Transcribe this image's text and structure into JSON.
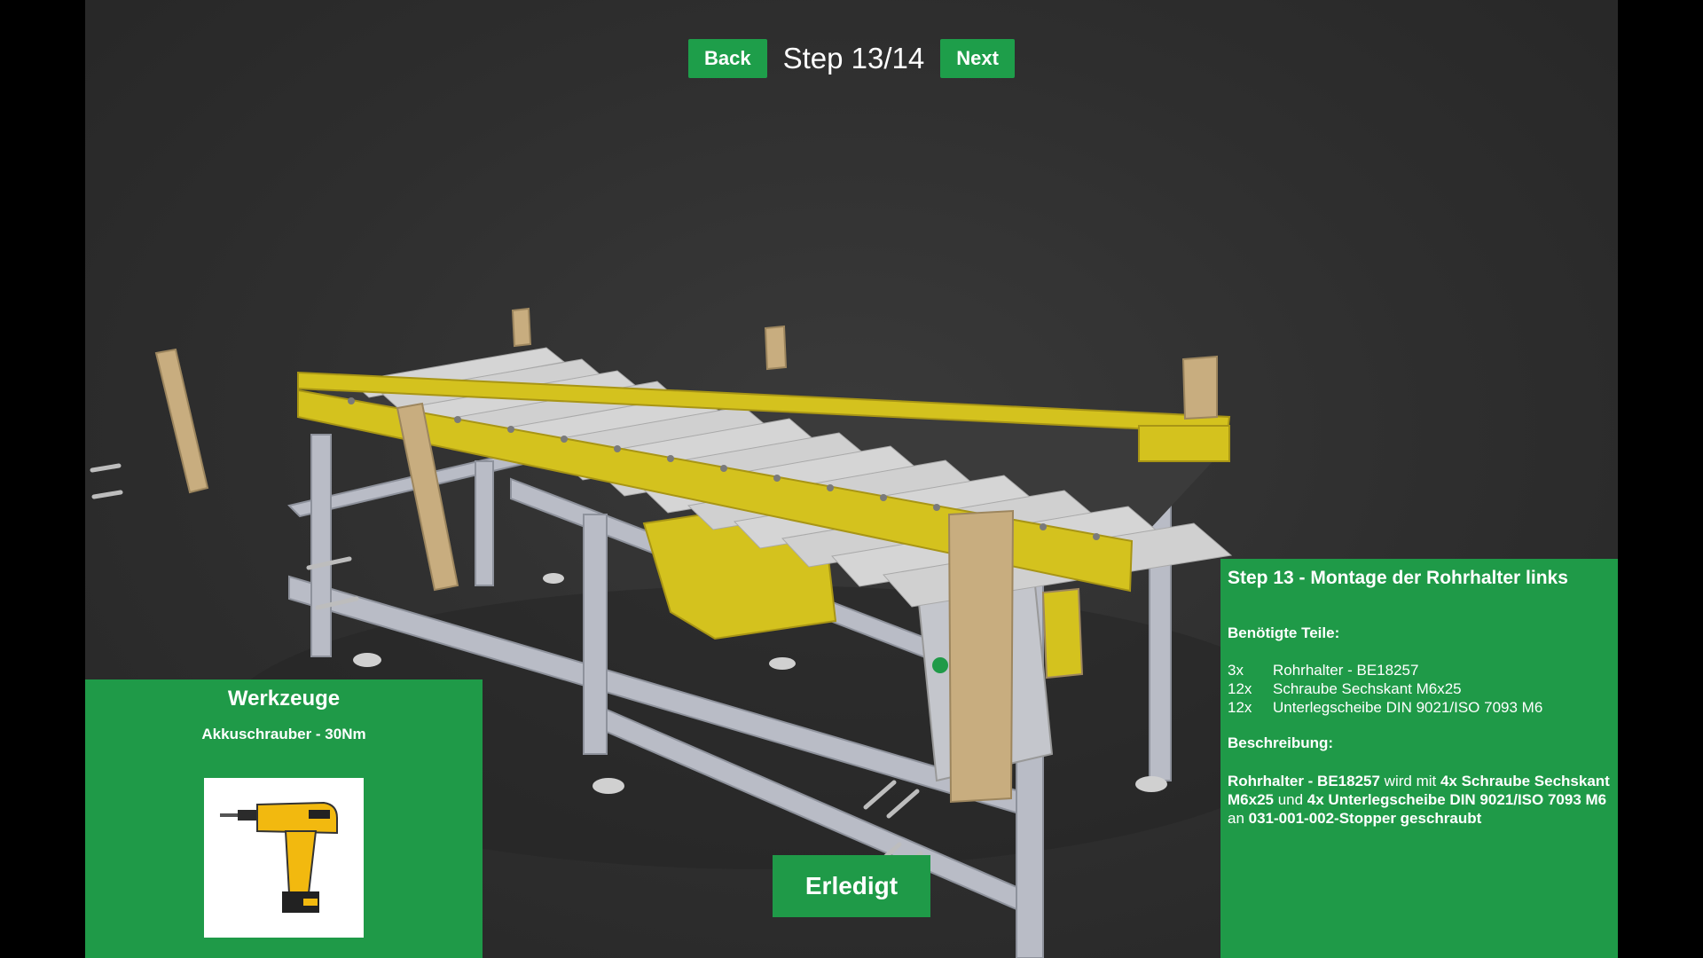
{
  "nav": {
    "back_label": "Back",
    "step_text": "Step 13/14",
    "next_label": "Next"
  },
  "tools_panel": {
    "title": "Werkzeuge",
    "tool_name": "Akkuschrauber - 30Nm",
    "tool_icon": "cordless-drill-icon"
  },
  "info_panel": {
    "title": "Step 13 - Montage der Rohrhalter links",
    "parts_heading": "Benötigte Teile:",
    "parts": [
      {
        "qty": "3x",
        "name": "Rohrhalter - BE18257"
      },
      {
        "qty": "12x",
        "name": "Schraube Sechskant M6x25"
      },
      {
        "qty": "12x",
        "name": "Unterlegscheibe DIN 9021/ISO 7093 M6"
      }
    ],
    "description_heading": "Beschreibung:",
    "description": {
      "part": "Rohrhalter - BE18257",
      "t1": " wird mit ",
      "screws": "4x Schraube Sechskant M6x25",
      "t2": " und ",
      "washers": "4x Unterlegscheibe DIN 9021/ISO 7093 M6",
      "t3": " an ",
      "target": "031-001-002-Stopper geschraubt"
    }
  },
  "done_label": "Erledigt",
  "colors": {
    "accent_green": "#1f9a48",
    "frame_yellow": "#d4c21e",
    "roller_grey": "#c9c9c9",
    "frame_steel": "#b9bcc6",
    "bracket_tan": "#c8ad7f"
  }
}
